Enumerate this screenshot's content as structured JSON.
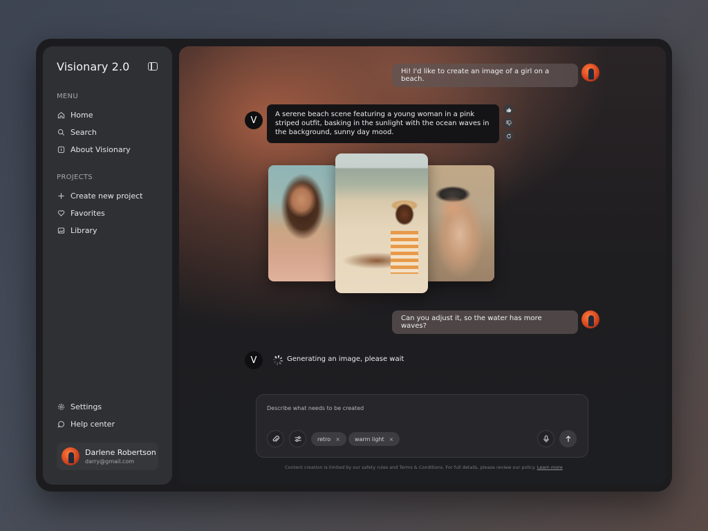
{
  "app": {
    "title": "Visionary 2.0"
  },
  "sidebar": {
    "menu_label": "MENU",
    "menu_items": [
      {
        "label": "Home",
        "icon": "home-icon"
      },
      {
        "label": "Search",
        "icon": "search-icon"
      },
      {
        "label": "About Visionary",
        "icon": "info-icon"
      }
    ],
    "projects_label": "PROJECTS",
    "project_items": [
      {
        "label": "Create new project",
        "icon": "plus-icon"
      },
      {
        "label": "Favorites",
        "icon": "heart-icon"
      },
      {
        "label": "Library",
        "icon": "image-icon"
      }
    ],
    "bottom_items": [
      {
        "label": "Settings",
        "icon": "gear-icon"
      },
      {
        "label": "Help center",
        "icon": "chat-bubble-icon"
      }
    ],
    "user": {
      "name": "Darlene Robertson",
      "email": "darry@gmail.com"
    }
  },
  "chat": {
    "bot_initial": "V",
    "messages": [
      {
        "role": "user",
        "text": "Hi! I'd like to create an image of a girl on a beach."
      },
      {
        "role": "assistant",
        "text": "A serene beach scene featuring a young woman in a pink striped outfit, basking in the sunlight with the ocean waves in the background, sunny day mood."
      },
      {
        "role": "user",
        "text": "Can you adjust it, so the water has more waves?"
      }
    ],
    "status": "Generating an image, please wait"
  },
  "composer": {
    "placeholder": "Describe what needs to be created",
    "tags": [
      "retro",
      "warm light"
    ],
    "tag_remove": "×"
  },
  "footer": {
    "note": "Content creation is limited by our safety rules and Terms & Conditions. For full details, please review our policy.",
    "link": "Learn more"
  },
  "colors": {
    "panel": "#2f3034",
    "frame": "#1c1c1f",
    "accent_warm": "#b4644a"
  }
}
